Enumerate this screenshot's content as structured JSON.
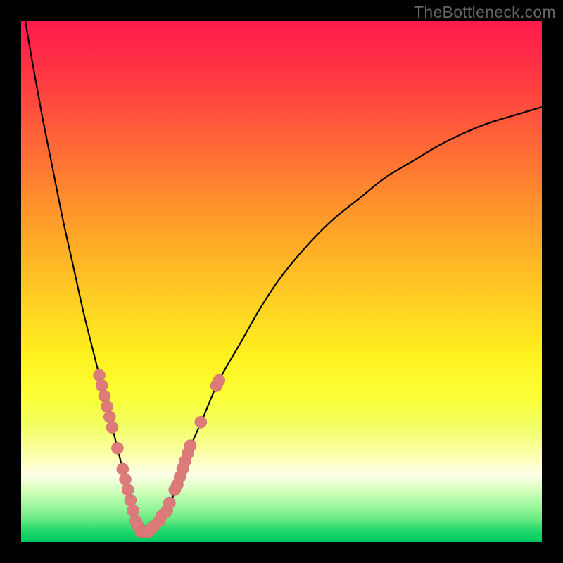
{
  "watermark": "TheBottleneck.com",
  "colors": {
    "curve_stroke": "#000000",
    "marker_fill": "#dd7a7a",
    "marker_stroke": "#cc6a6a",
    "frame_bg": "#000000"
  },
  "chart_data": {
    "type": "line",
    "title": "",
    "xlabel": "",
    "ylabel": "",
    "xlim": [
      0,
      100
    ],
    "ylim": [
      0,
      100
    ],
    "series": [
      {
        "name": "curve",
        "x": [
          0,
          2,
          4,
          6,
          8,
          10,
          12,
          14,
          16,
          18,
          19,
          20,
          21,
          22,
          23,
          24,
          26,
          28,
          30,
          32,
          35,
          38,
          42,
          46,
          50,
          55,
          60,
          65,
          70,
          75,
          80,
          85,
          90,
          95,
          100
        ],
        "y": [
          105,
          93,
          82,
          72,
          62,
          53,
          44,
          36,
          28,
          20,
          16,
          12,
          8,
          4,
          2,
          2,
          3,
          6,
          11,
          17,
          24,
          31,
          38,
          45,
          51,
          57,
          62,
          66,
          70,
          73,
          76,
          78.5,
          80.5,
          82,
          83.5
        ]
      }
    ],
    "markers": [
      {
        "x": 15.0,
        "y": 32
      },
      {
        "x": 15.5,
        "y": 30
      },
      {
        "x": 16.0,
        "y": 28
      },
      {
        "x": 16.5,
        "y": 26
      },
      {
        "x": 17.0,
        "y": 24
      },
      {
        "x": 17.5,
        "y": 22
      },
      {
        "x": 18.5,
        "y": 18
      },
      {
        "x": 19.5,
        "y": 14
      },
      {
        "x": 20.0,
        "y": 12
      },
      {
        "x": 20.5,
        "y": 10
      },
      {
        "x": 21.0,
        "y": 8
      },
      {
        "x": 21.5,
        "y": 6
      },
      {
        "x": 22.0,
        "y": 4
      },
      {
        "x": 22.5,
        "y": 3
      },
      {
        "x": 23.0,
        "y": 2
      },
      {
        "x": 23.5,
        "y": 2
      },
      {
        "x": 24.0,
        "y": 2
      },
      {
        "x": 24.5,
        "y": 2
      },
      {
        "x": 25.0,
        "y": 2.5
      },
      {
        "x": 25.5,
        "y": 3
      },
      {
        "x": 26.5,
        "y": 4
      },
      {
        "x": 27.0,
        "y": 5
      },
      {
        "x": 28.0,
        "y": 6
      },
      {
        "x": 28.5,
        "y": 7.5
      },
      {
        "x": 29.5,
        "y": 10
      },
      {
        "x": 30.0,
        "y": 11
      },
      {
        "x": 30.5,
        "y": 12.5
      },
      {
        "x": 31.0,
        "y": 14
      },
      {
        "x": 31.5,
        "y": 15.5
      },
      {
        "x": 32.0,
        "y": 17
      },
      {
        "x": 32.5,
        "y": 18.5
      },
      {
        "x": 34.5,
        "y": 23
      },
      {
        "x": 37.5,
        "y": 30
      },
      {
        "x": 38.0,
        "y": 31
      }
    ]
  }
}
